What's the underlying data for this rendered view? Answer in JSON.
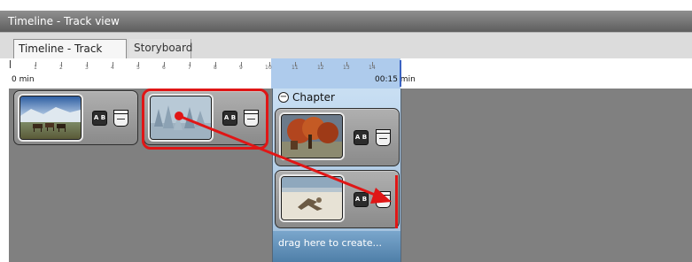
{
  "window": {
    "title": "Timeline - Track view"
  },
  "tabs": [
    {
      "label": "Timeline - Track view",
      "active": true
    },
    {
      "label": "Storyboard",
      "active": false
    }
  ],
  "ruler": {
    "ticks": [
      "1",
      "2",
      "3",
      "4",
      "5",
      "6",
      "7",
      "8",
      "9",
      "10",
      "11",
      "12",
      "13",
      "14"
    ],
    "start_label": "0 min",
    "end_label": "00:15 min"
  },
  "track": {
    "clips": [
      {
        "thumbnail": "horses-landscape",
        "transition_icon": "ab-transition-icon",
        "effect_icon": "film-effect-icon"
      },
      {
        "thumbnail": "snowy-forest",
        "transition_icon": "ab-transition-icon",
        "effect_icon": "film-effect-icon",
        "selected": true
      }
    ],
    "chapter": {
      "label": "Chapter",
      "clips": [
        {
          "thumbnail": "autumn-tree",
          "transition_icon": "ab-transition-icon",
          "effect_icon": "film-effect-icon"
        },
        {
          "thumbnail": "beach-driftwood",
          "transition_icon": "ab-transition-icon",
          "effect_icon": "film-effect-icon"
        }
      ],
      "drop_hint": "drag here to create..."
    }
  },
  "ab_text": "A B",
  "colors": {
    "selection_highlight": "#e01616",
    "chapter_background": "#aecbec",
    "track_background": "#808080",
    "title_bar": "#6e6e6e"
  }
}
